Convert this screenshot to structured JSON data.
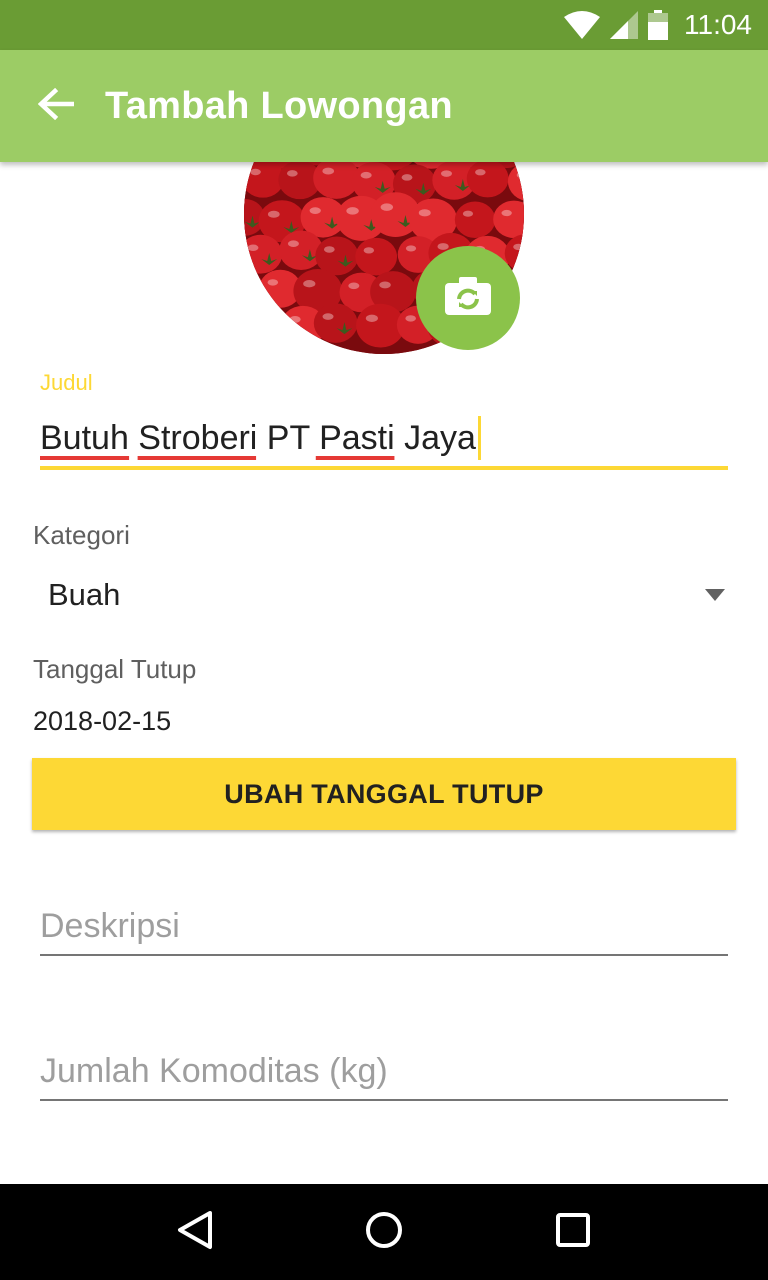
{
  "status_bar": {
    "time": "11:04",
    "icons": [
      "wifi-icon",
      "signal-icon",
      "battery-icon"
    ]
  },
  "app_bar": {
    "back_icon": "arrow-back-icon",
    "title": "Tambah Lowongan"
  },
  "photo": {
    "camera_icon": "switch-camera-icon"
  },
  "form": {
    "judul_label": "Judul",
    "judul_value": "Butuh Stroberi PT Pasti Jaya",
    "kategori_label": "Kategori",
    "kategori_value": "Buah",
    "tanggal_label": "Tanggal Tutup",
    "tanggal_value": "2018-02-15",
    "ubah_button": "UBAH TANGGAL TUTUP",
    "deskripsi_placeholder": "Deskripsi",
    "jumlah_placeholder": "Jumlah Komoditas (kg)"
  },
  "nav_bar": {
    "icons": [
      "back-triangle-icon",
      "home-circle-icon",
      "recents-square-icon"
    ]
  },
  "colors": {
    "status_bar": "#6a9c34",
    "app_bar": "#9ccc65",
    "fab": "#8bc34a",
    "accent": "#fdd835"
  }
}
